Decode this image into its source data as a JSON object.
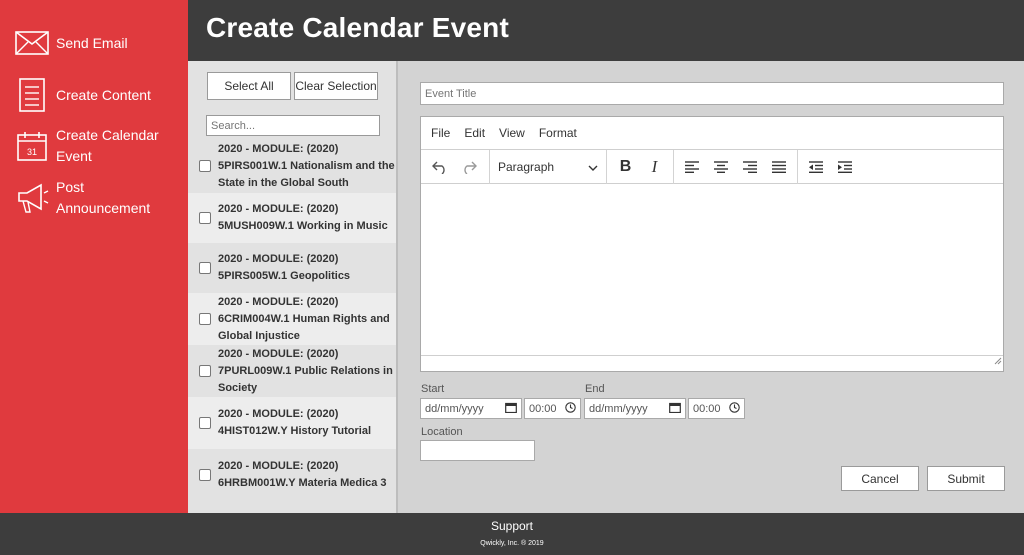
{
  "header": {
    "title": "Create Calendar Event"
  },
  "sidebar": {
    "items": [
      {
        "label": "Send Email",
        "icon": "mail-icon"
      },
      {
        "label": "Create Content",
        "icon": "document-icon"
      },
      {
        "label": "Create Calendar Event",
        "icon": "calendar-icon"
      },
      {
        "label": "Post Announcement",
        "icon": "megaphone-icon"
      }
    ]
  },
  "list": {
    "select_all": "Select All",
    "clear_selection": "Clear Selection",
    "search_placeholder": "Search...",
    "courses": [
      "2020 - MODULE: (2020) 5PIRS001W.1 Nationalism and the State in the Global South",
      "2020 - MODULE: (2020) 5MUSH009W.1 Working in Music",
      "2020 - MODULE: (2020) 5PIRS005W.1 Geopolitics",
      "2020 - MODULE: (2020) 6CRIM004W.1 Human Rights and Global Injustice",
      "2020 - MODULE: (2020) 7PURL009W.1 Public Relations in Society",
      "2020 - MODULE: (2020) 4HIST012W.Y History Tutorial",
      "2020 - MODULE: (2020) 6HRBM001W.Y Materia Medica 3"
    ]
  },
  "form": {
    "title_placeholder": "Event Title",
    "menu": [
      "File",
      "Edit",
      "View",
      "Format"
    ],
    "block_format": "Paragraph",
    "start_label": "Start",
    "end_label": "End",
    "date_placeholder": "dd/mm/yyyy",
    "time_value": "00:00",
    "location_label": "Location",
    "cancel": "Cancel",
    "submit": "Submit"
  },
  "footer": {
    "support": "Support",
    "copyright": "Qwickly, Inc. ® 2019"
  },
  "colors": {
    "sidebar": "#e03a3e",
    "header": "#3d3d3d"
  }
}
